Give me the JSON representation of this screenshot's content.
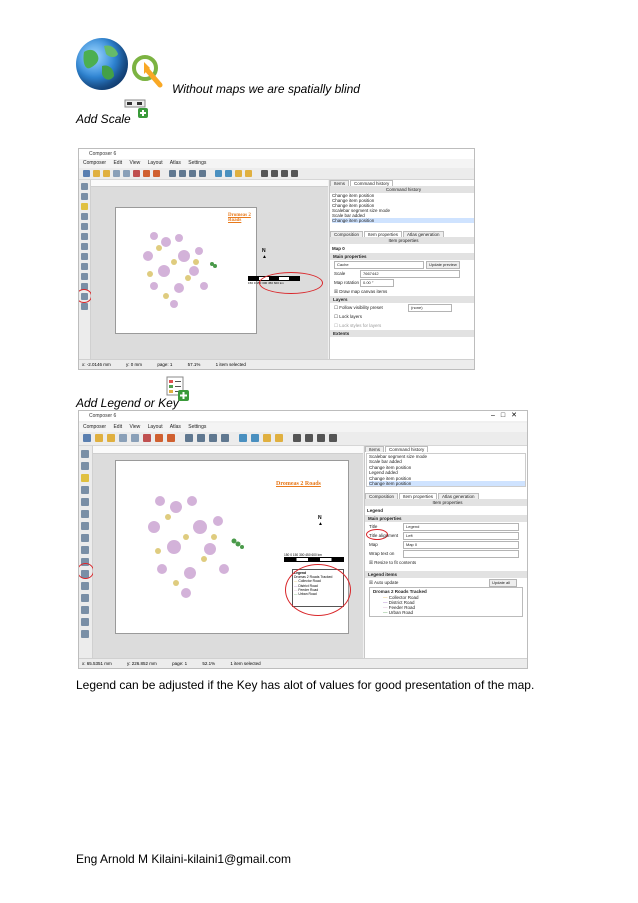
{
  "doc": {
    "tagline": "Without maps we are spatially blind",
    "step1": "Add Scale",
    "step2": "Add Legend or Key",
    "note": "Legend can be adjusted if the Key has alot of values for good presentation of the map.",
    "footer": "Eng Arnold M Kilaini-kilaini1@gmail.com"
  },
  "shot1": {
    "window_title": "Composer 6",
    "menu": [
      "Composer",
      "Edit",
      "View",
      "Layout",
      "Atlas",
      "Settings"
    ],
    "map_title": "Dromeas 2 Roads",
    "scale_labels": "150   0   150  300  450  600 km",
    "panel_tabs": [
      "Items",
      "Command history"
    ],
    "history_header": "Command history",
    "history": [
      "Change item position",
      "Change item position",
      "Change item position",
      "Scalebar segment size mode",
      "Scale bar added",
      "Change item position"
    ],
    "props_tabs": [
      "Composition",
      "Item properties",
      "Atlas generation"
    ],
    "props_header": "Item properties",
    "item_name": "Map 0",
    "section_main": "Main properties",
    "cache_value": "Cache",
    "update_preview": "Update preview",
    "scale_label": "Scale",
    "scale_value": "7667442",
    "rotation_label": "Map rotation",
    "rotation_value": "0.00 °",
    "draw_canvas": "Draw map canvas items",
    "section_layers": "Layers",
    "follow_preset": "Follow visibility preset",
    "preset_value": "(none)",
    "lock_layers": "Lock layers",
    "lock_styles": "Lock styles for layers",
    "section_extents": "Extents",
    "status": [
      "x: -2.0146 mm",
      "y: 0 mm",
      "page: 1",
      "57.1%",
      "1 item selected"
    ]
  },
  "shot2": {
    "window_title": "Composer 6",
    "menu": [
      "Composer",
      "Edit",
      "View",
      "Layout",
      "Atlas",
      "Settings"
    ],
    "map_title": "Dromeas 2 Roads",
    "scale_labels": "150   0   150  300  450  600 km",
    "panel_tabs": [
      "Items",
      "Command history"
    ],
    "history": [
      "Scalebar segment size mode",
      "Scale bar added",
      "Change item position",
      "Legend added",
      "Change item position",
      "Change item position"
    ],
    "props_tabs": [
      "Composition",
      "Item properties",
      "Atlas generation"
    ],
    "props_header": "Item properties",
    "item_name": "Legend",
    "section_main": "Main properties",
    "title_label": "Title",
    "title_value": "Legend",
    "align_label": "Title alignment",
    "align_value": "Left",
    "map_label": "Map",
    "map_value": "Map 0",
    "wrap_label": "Wrap text on",
    "resize": "Resize to fit contents",
    "section_items": "Legend items",
    "auto_update": "Auto update",
    "update_all": "Update all",
    "layer_group": "Dromas 2 Roads Tracked",
    "road_items": [
      {
        "name": "Collector Road",
        "color": "#e6b84a"
      },
      {
        "name": "District Road",
        "color": "#9b5fc0"
      },
      {
        "name": "Feeder Road",
        "color": "#d8a0c8"
      },
      {
        "name": "Urban Road",
        "color": "#4a9a4a"
      }
    ],
    "legend_box_title": "Legend",
    "legend_box_items": [
      "Dromas 2 Roads Tracked",
      "Collector Road",
      "District Road",
      "Feeder Road",
      "Urban Road"
    ],
    "status": [
      "x: 65.5351 mm",
      "y: 226.852 mm",
      "page: 1",
      "52.1%",
      "1 item selected"
    ]
  }
}
